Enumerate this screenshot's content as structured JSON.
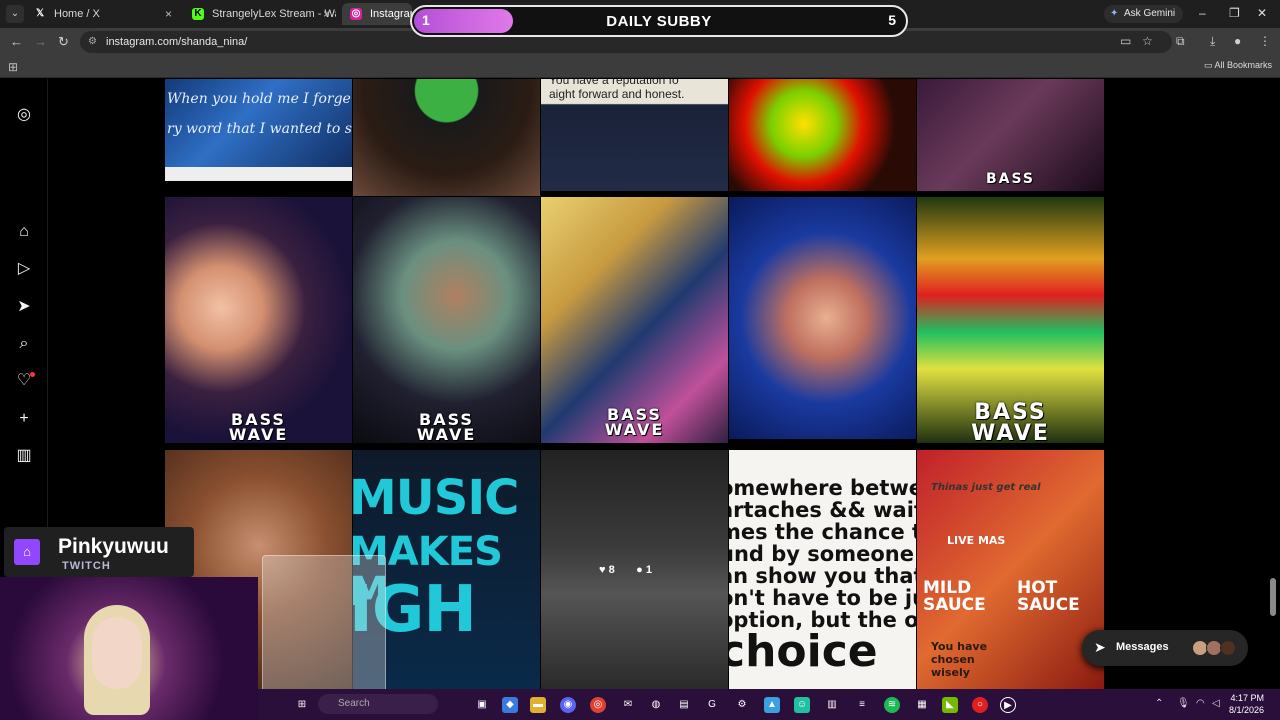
{
  "browser": {
    "tabs": [
      {
        "label": "Home / X",
        "icon": "x-logo-icon"
      },
      {
        "label": "StrangelyLex Stream - Watch Li",
        "icon": "kick-logo-icon"
      },
      {
        "label": "Instagram",
        "icon": "instagram-logo-icon"
      }
    ],
    "ask_gemini": "Ask Gemini",
    "url": "instagram.com/shanda_nina/",
    "all_bookmarks": "All Bookmarks"
  },
  "subby_overlay": {
    "current": "1",
    "title": "DAILY SUBBY",
    "goal": "5",
    "progress_fraction": 0.2
  },
  "instagram": {
    "sidebar_icons": [
      "instagram-logo-icon",
      "home-icon",
      "reels-icon",
      "send-icon",
      "search-icon",
      "heart-icon",
      "create-icon",
      "insights-icon",
      "profile-avatar"
    ],
    "grid": {
      "row1": [
        {
          "text": [
            "When you hold me I forge",
            "ry word that I wanted to s"
          ]
        },
        {
          "text": []
        },
        {
          "text": [
            "You have a reputation fo",
            "aight forward and honest."
          ]
        },
        {
          "text": []
        },
        {
          "text": [
            "BASS"
          ]
        }
      ],
      "row2": [
        {
          "text": [
            "BASS",
            "WAVE"
          ]
        },
        {
          "text": [
            "BASS",
            "WAVE"
          ]
        },
        {
          "text": [
            "BASS",
            "WAVE"
          ]
        },
        {
          "text": []
        },
        {
          "text": [
            "BASS",
            "WAVE"
          ]
        }
      ],
      "row3_music": [
        "MUSIC",
        "MAKES M",
        "IGH"
      ],
      "row3_hover": {
        "likes": "8",
        "comments": "1"
      },
      "row3_quote": [
        "omewhere between",
        "artaches && waiti",
        "mes the chance to",
        "und by someone w",
        "an show you that y",
        "on't have to be jus",
        "option, but the on"
      ],
      "row3_quote_big": "choice",
      "row3_sauce": [
        "Thinas just get real",
        "LIVE MAS",
        "MILD SAUCE",
        "HOT SAUCE",
        "You have chosen wisely"
      ]
    },
    "messages_label": "Messages"
  },
  "twitch_overlay": {
    "username": "Pinkyuwuu",
    "platform": "TWITCH"
  },
  "taskbar": {
    "search_placeholder": "Search",
    "time": "4:17 PM",
    "date": "8/1/2026"
  }
}
